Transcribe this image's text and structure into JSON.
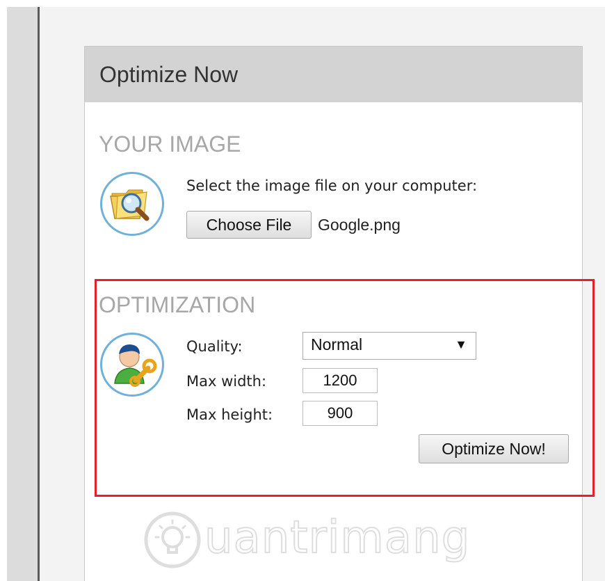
{
  "panel": {
    "title": "Optimize Now"
  },
  "your_image": {
    "heading": "YOUR IMAGE",
    "prompt": "Select the image file on your computer:",
    "choose_file_label": "Choose File",
    "file_name": "Google.png",
    "icon": "folder-magnifier-icon"
  },
  "optimization": {
    "heading": "OPTIMIZATION",
    "icon": "user-wrench-icon",
    "quality_label": "Quality:",
    "quality_value": "Normal",
    "max_width_label": "Max width:",
    "max_width_value": "1200",
    "max_height_label": "Max height:",
    "max_height_value": "900",
    "submit_label": "Optimize Now!"
  },
  "watermark": {
    "text": "uantrimang"
  },
  "colors": {
    "highlight": "#e5202a",
    "icon_ring": "#6fb1d9",
    "section_heading": "#a7a7a7",
    "header_bg": "#d3d3d3"
  }
}
